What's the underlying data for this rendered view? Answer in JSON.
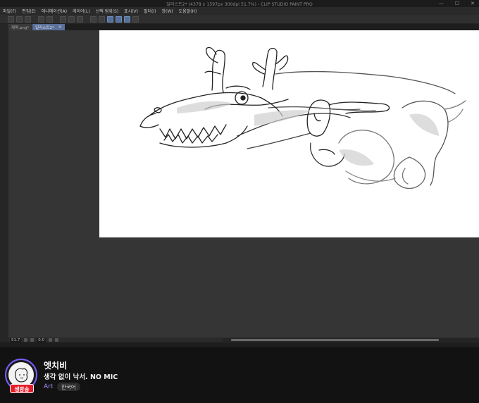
{
  "window": {
    "title": "일러스트2* (4378 x 1597px 300dpi 51.7%) - CLIP STUDIO PAINT PRO",
    "controls": [
      "—",
      "☐",
      "✕"
    ]
  },
  "menu": [
    "파일(F)",
    "편집(E)",
    "애니메이션(A)",
    "레이어(L)",
    "선택 범위(S)",
    "표시(V)",
    "필터(I)",
    "창(W)",
    "도움말(H)"
  ],
  "tabs": [
    {
      "label": "제목.png*",
      "active": false
    },
    {
      "label": "일러스트2*",
      "active": true,
      "close": "×"
    }
  ],
  "status": {
    "zoom": "51.7",
    "angle": "0.0"
  },
  "stream": {
    "channel_name": "엣치비",
    "title": "생각 없이 낙서. NO MIC",
    "category": "Art",
    "language_tag": "한국어",
    "live_badge": "생방송",
    "accent_color": "#7b5bff",
    "live_color": "#e51d2a"
  }
}
